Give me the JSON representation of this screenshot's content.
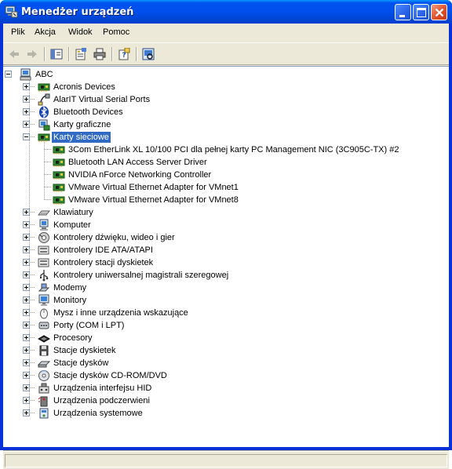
{
  "window": {
    "title": "Menedżer urządzeń"
  },
  "menu": [
    "Plik",
    "Akcja",
    "Widok",
    "Pomoc"
  ],
  "toolbar": [
    "back-arrow-icon",
    "forward-arrow-icon",
    "show-hide-console-tree-icon",
    "properties-icon",
    "print-icon",
    "help-icon",
    "scan-hardware-icon"
  ],
  "tree": {
    "root": "ABC",
    "categories": [
      {
        "label": "Acronis Devices",
        "icon": "chip-board-icon"
      },
      {
        "label": "AlarIT Virtual Serial Ports",
        "icon": "serial-port-icon"
      },
      {
        "label": "Bluetooth Devices",
        "icon": "bluetooth-icon"
      },
      {
        "label": "Karty graficzne",
        "icon": "display-adapter-icon"
      },
      {
        "label": "Karty sieciowe",
        "icon": "network-adapter-icon",
        "expanded": true,
        "selected": true,
        "children": [
          "3Com EtherLink XL 10/100 PCI dla pełnej karty PC Management NIC (3C905C-TX) #2",
          "Bluetooth LAN Access Server Driver",
          "NVIDIA nForce Networking Controller",
          "VMware Virtual Ethernet Adapter for VMnet1",
          "VMware Virtual Ethernet Adapter for VMnet8"
        ]
      },
      {
        "label": "Klawiatury",
        "icon": "keyboard-icon"
      },
      {
        "label": "Komputer",
        "icon": "computer-icon"
      },
      {
        "label": "Kontrolery dźwięku, wideo i gier",
        "icon": "sound-icon"
      },
      {
        "label": "Kontrolery IDE ATA/ATAPI",
        "icon": "ide-controller-icon"
      },
      {
        "label": "Kontrolery stacji dyskietek",
        "icon": "floppy-controller-icon"
      },
      {
        "label": "Kontrolery uniwersalnej magistrali szeregowej",
        "icon": "usb-icon"
      },
      {
        "label": "Modemy",
        "icon": "modem-icon"
      },
      {
        "label": "Monitory",
        "icon": "monitor-icon"
      },
      {
        "label": "Mysz i inne urządzenia wskazujące",
        "icon": "mouse-icon"
      },
      {
        "label": "Porty (COM i LPT)",
        "icon": "port-icon"
      },
      {
        "label": "Procesory",
        "icon": "processor-icon"
      },
      {
        "label": "Stacje dyskietek",
        "icon": "floppy-drive-icon"
      },
      {
        "label": "Stacje dysków",
        "icon": "disk-drive-icon"
      },
      {
        "label": "Stacje dysków CD-ROM/DVD",
        "icon": "cdrom-icon"
      },
      {
        "label": "Urządzenia interfejsu HID",
        "icon": "hid-icon"
      },
      {
        "label": "Urządzenia podczerwieni",
        "icon": "infrared-icon"
      },
      {
        "label": "Urządzenia systemowe",
        "icon": "system-device-icon"
      }
    ]
  },
  "colors": {
    "selection": "#316ac5",
    "titlebar": "#0053ee",
    "chrome": "#ece9d8"
  }
}
